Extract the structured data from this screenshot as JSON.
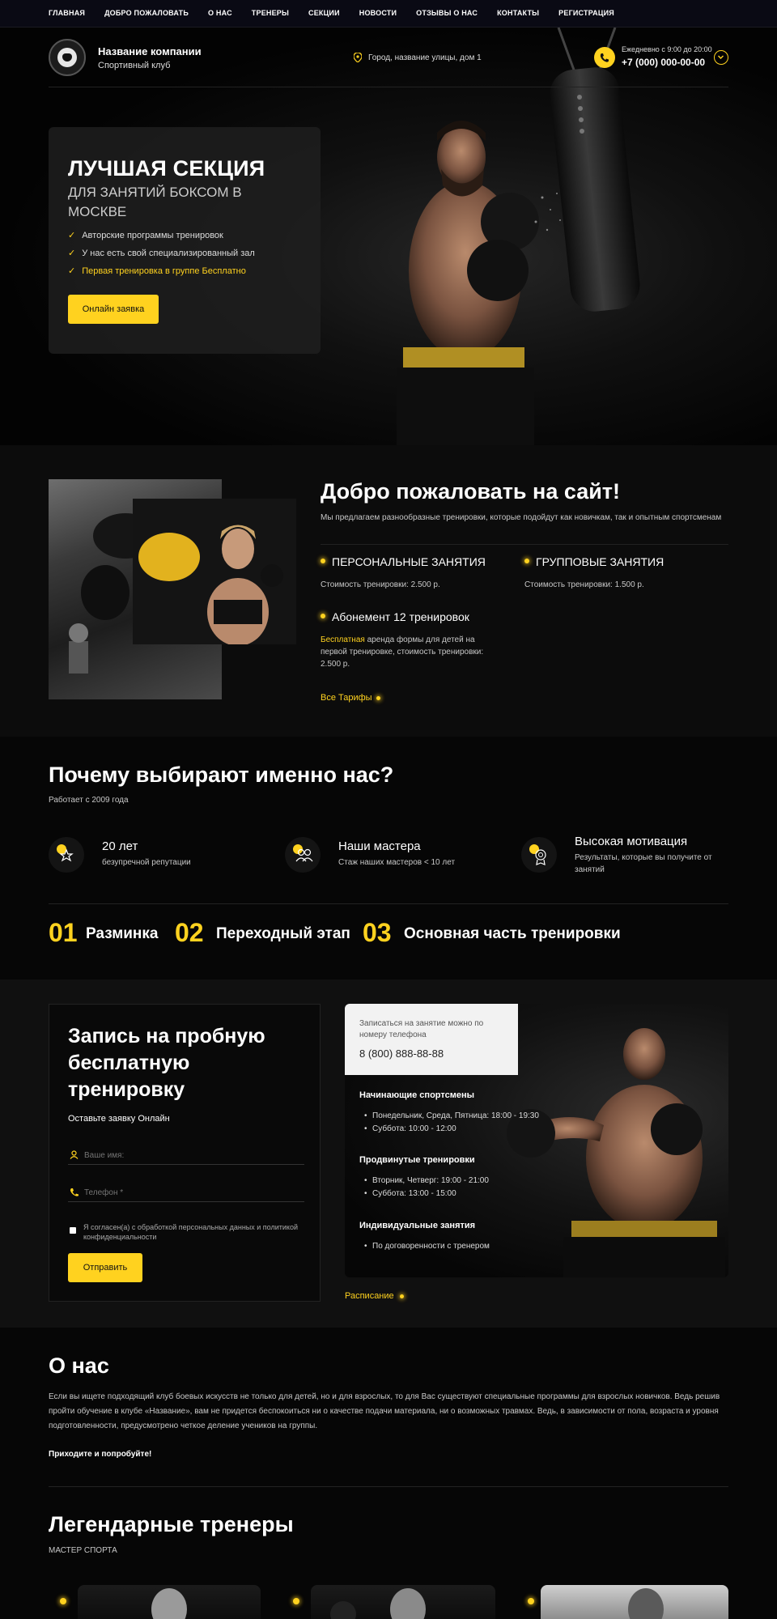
{
  "nav": [
    "ГЛАВНАЯ",
    "ДОБРО ПОЖАЛОВАТЬ",
    "О НАС",
    "ТРЕНЕРЫ",
    "СЕКЦИИ",
    "НОВОСТИ",
    "ОТЗЫВЫ О НАС",
    "КОНТАКТЫ",
    "РЕГИСТРАЦИЯ"
  ],
  "header": {
    "company": "Название компании",
    "company_sub": "Спортивный клуб",
    "address": "Город, название улицы, дом 1",
    "hours": "Ежедневно с 9:00 до 20:00",
    "phone": "+7 (000) 000-00-00"
  },
  "hero": {
    "title": "ЛУЧШАЯ СЕКЦИЯ",
    "subtitle": "ДЛЯ ЗАНЯТИЙ БОКСОМ В МОСКВЕ",
    "checks": [
      "Авторские программы тренировок",
      "У нас есть свой специализированный зал",
      "Первая тренировка в группе Бесплатно"
    ],
    "button": "Онлайн заявка"
  },
  "welcome": {
    "title": "Добро пожаловать на сайт!",
    "text": "Мы предлагаем разнообразные тренировки, которые подойдут как новичкам, так и опытным спортсменам",
    "items": [
      {
        "title": "ПЕРСОНАЛЬНЫЕ ЗАНЯТИЯ",
        "desc": "Стоимость тренировки: 2.500 р."
      },
      {
        "title": "ГРУППОВЫЕ ЗАНЯТИЯ",
        "desc": "Стоимость тренировки: 1.500 р."
      },
      {
        "title": "Абонемент 12 тренировок",
        "desc_hl": "Бесплатная",
        "desc": " аренда формы для детей на первой тренировке, стоимость тренировки: 2.500 р."
      }
    ],
    "link": "Все Тарифы"
  },
  "why": {
    "title": "Почему выбирают именно нас?",
    "subtitle": "Работает с 2009 года",
    "features": [
      {
        "title": "20 лет",
        "desc": "безупречной репутации",
        "icon": "stars-icon"
      },
      {
        "title": "Наши мастера",
        "desc": "Стаж наших мастеров < 10 лет",
        "icon": "team-icon"
      },
      {
        "title": "Высокая мотивация",
        "desc": "Результаты, которые вы получите от занятий",
        "icon": "medal-icon"
      }
    ],
    "steps": [
      {
        "num": "01",
        "label": "Разминка"
      },
      {
        "num": "02",
        "label": "Переходный этап"
      },
      {
        "num": "03",
        "label": "Основная часть тренировки"
      }
    ]
  },
  "form": {
    "title": "Запись на пробную бесплатную тренировку",
    "subtitle": "Оставьте заявку Онлайн",
    "name_placeholder": "Ваше имя:",
    "phone_placeholder": "Телефон *",
    "consent": "Я согласен(а) с обработкой персональных данных и политикой конфиденциальности",
    "button": "Отправить"
  },
  "schedule": {
    "tip_text": "Записаться на занятие можно по номеру телефона",
    "tip_phone": "8 (800) 888-88-88",
    "groups": [
      {
        "title": "Начинающие спортсмены",
        "items": [
          "Понедельник, Среда, Пятница: 18:00 - 19:30",
          "Суббота: 10:00 - 12:00"
        ]
      },
      {
        "title": "Продвинутые тренировки",
        "items": [
          "Вторник, Четверг: 19:00 - 21:00",
          "Суббота: 13:00 - 15:00"
        ]
      },
      {
        "title": "Индивидуальные занятия",
        "items": [
          "По договоренности с тренером"
        ]
      }
    ],
    "link": "Расписание"
  },
  "about": {
    "title": "О нас",
    "text": "Если вы ищете подходящий клуб боевых искусств не только для детей, но и для взрослых, то для Вас существуют специальные программы для взрослых новичков. Ведь решив пройти обучение в клубе «Название», вам не придется беспокоиться ни о качестве подачи материала, ни о возможных травмах. Ведь, в зависимости от пола, возраста и уровня подготовленности, предусмотрено четкое деление учеников на группы.",
    "cta": "Приходите и попробуйте!"
  },
  "trainers": {
    "title": "Легендарные тренеры",
    "subtitle": "МАСТЕР СПОРТА"
  },
  "colors": {
    "accent": "#ffd21f",
    "bg": "#060606"
  }
}
